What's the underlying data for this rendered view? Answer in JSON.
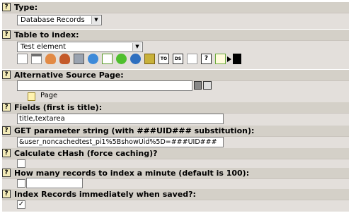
{
  "type": {
    "label": "Type:",
    "value": "Database Records"
  },
  "table": {
    "label": "Table to index:",
    "value": "Test element"
  },
  "table_icons": [
    "document-icon",
    "document-text-icon",
    "user-icon",
    "user-group-icon",
    "monitor-icon",
    "globe-page-icon",
    "dollar-page-icon",
    "dollar-green-icon",
    "dollar-globe-icon",
    "dollar-cart-icon",
    "TO",
    "DS",
    "blank-page-icon",
    "help-icon",
    "edit-page-icon",
    "arrow-right-icon",
    "black-page-icon"
  ],
  "alt_source": {
    "label": "Alternative Source Page:",
    "value": "",
    "page_item": "Page"
  },
  "fields": {
    "label": "Fields (first is title):",
    "value": "title,textarea"
  },
  "get_param": {
    "label": "GET parameter string (with ###UID### substitution):",
    "value": "&user_noncachedtest_pi1%5BshowUid%5D=###UID###"
  },
  "chash": {
    "label": "Calculate cHash (force caching)?",
    "checked": false
  },
  "records_per_min": {
    "label": "How many records to index a minute (default is 100):",
    "value": ""
  },
  "index_immediately": {
    "label": "Index Records immediately when saved?:",
    "checked": true,
    "check_mark": "✓"
  },
  "help_glyph": "?"
}
